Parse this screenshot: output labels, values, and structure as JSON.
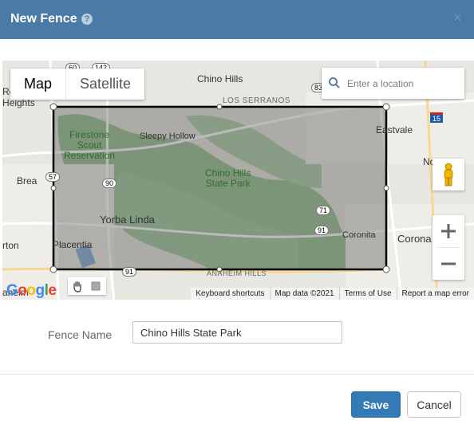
{
  "modal": {
    "title": "New Fence",
    "help_icon": "question-circle-icon",
    "close_icon": "close-icon"
  },
  "map": {
    "type_tabs": [
      {
        "label": "Map",
        "active": true
      },
      {
        "label": "Satellite",
        "active": false
      }
    ],
    "search": {
      "placeholder": "Enter a location",
      "value": ""
    },
    "place_labels": {
      "chino_hills": "Chino Hills",
      "los_serranos": "LOS SERRANOS",
      "eastvale": "Eastvale",
      "firestone_line1": "Firestone",
      "firestone_line2": "Scout",
      "firestone_line3": "Reservation",
      "sleepy_hollow": "Sleepy Hollow",
      "chino_park_line1": "Chino Hills",
      "chino_park_line2": "State Park",
      "brea": "Brea",
      "yorba_linda": "Yorba Linda",
      "placentia": "Placentia",
      "coronita": "Coronita",
      "corona": "Corona",
      "anaheim_hills": "ANAHEIM HILLS",
      "rowland_heights_part1": "Ro",
      "rowland_heights_part2": "Heights",
      "norco_part": "No",
      "orton_part": "rton",
      "anaheim_part": "aheim"
    },
    "shields": {
      "r60": "60",
      "r142": "142",
      "r83": "83",
      "r15": "15",
      "r57": "57",
      "r90": "90",
      "r71": "71",
      "r91": "91",
      "r91b": "91"
    },
    "footer": {
      "keyboard": "Keyboard shortcuts",
      "map_data": "Map data ©2021",
      "terms": "Terms of Use",
      "report": "Report a map error"
    },
    "logo": "Google",
    "zoom_in": "+",
    "zoom_out": "−"
  },
  "form": {
    "fence_name_label": "Fence Name",
    "fence_name_value": "Chino Hills State Park"
  },
  "buttons": {
    "save": "Save",
    "cancel": "Cancel"
  }
}
